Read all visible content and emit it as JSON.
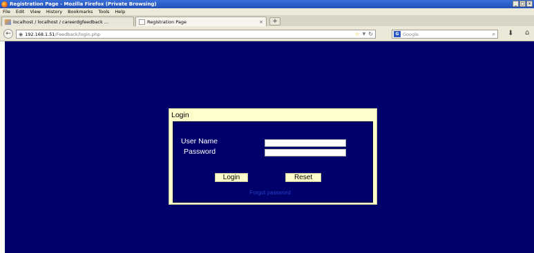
{
  "window": {
    "title": "Registration Page - Mozilla Firefox (Private Browsing)",
    "controls": [
      "_",
      "□",
      "×"
    ]
  },
  "menu": {
    "items": [
      "File",
      "Edit",
      "View",
      "History",
      "Bookmarks",
      "Tools",
      "Help"
    ]
  },
  "tabs": [
    {
      "label": "localhost / localhost / careerdgfeedback ...",
      "active": false
    },
    {
      "label": "Registration Page",
      "active": true,
      "close": "×"
    }
  ],
  "new_tab": "+",
  "nav": {
    "back": "←",
    "url_host": "192.168.1.51",
    "url_path": "/Feedback/login.php",
    "search_engine": "G",
    "search_placeholder": "Google"
  },
  "colors": {
    "page_background": "#00006b",
    "panel_background": "#ffffcc",
    "link": "#2a3cc8"
  },
  "login": {
    "title": "Login",
    "username_label": "User Name",
    "password_label": "Password",
    "username_value": "",
    "password_value": "",
    "login_button": "Login",
    "reset_button": "Reset",
    "forgot_link": "Forgot password"
  }
}
